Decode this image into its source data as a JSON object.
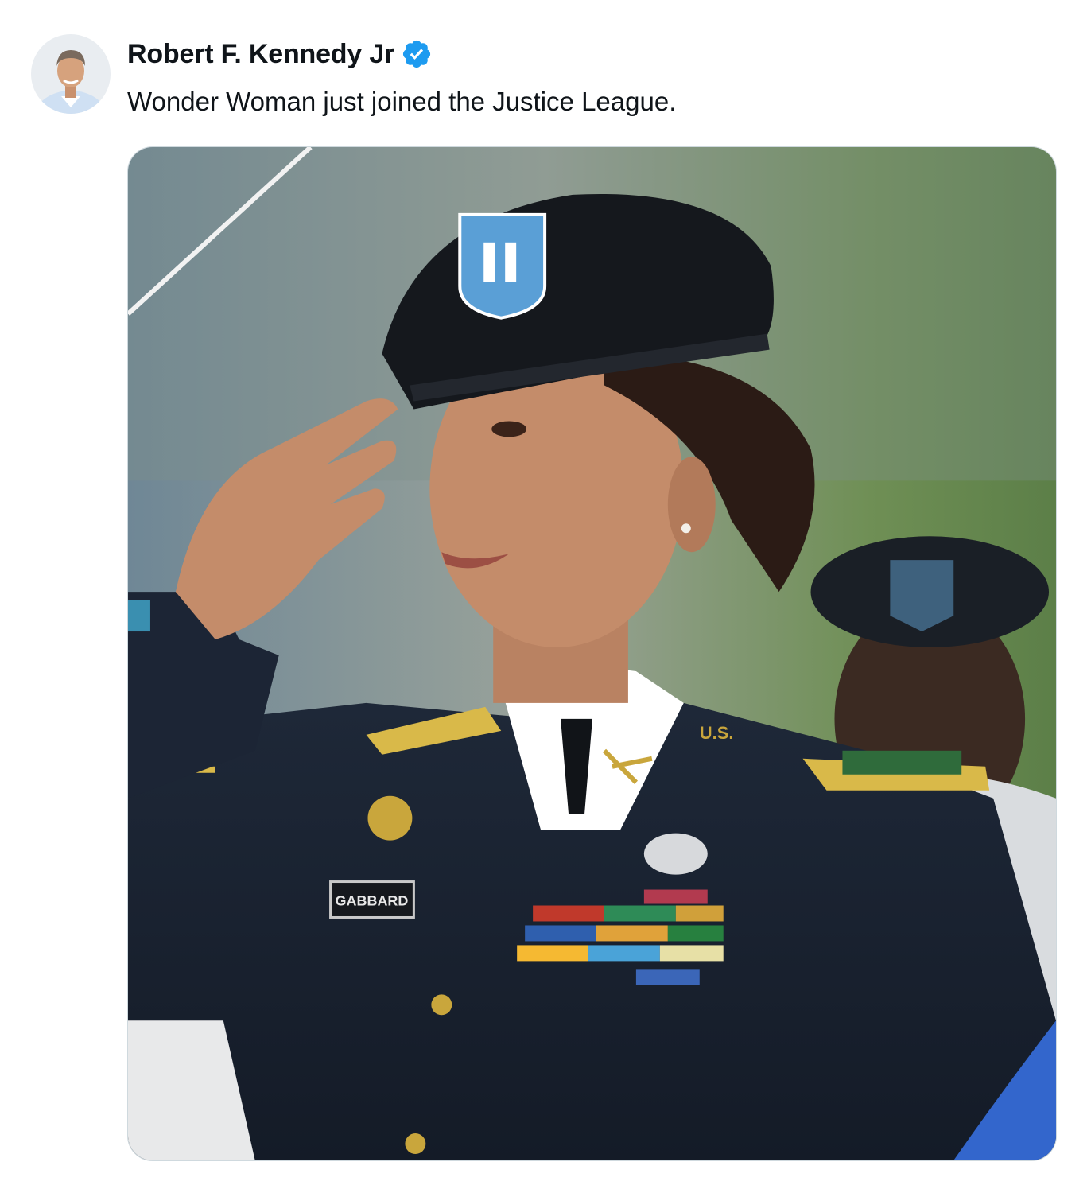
{
  "tweet": {
    "author": {
      "display_name": "Robert F. Kennedy Jr",
      "verified": true,
      "verified_color": "#1d9bf0",
      "avatar_icon": "profile-photo"
    },
    "text": "Wonder Woman just joined the Justice League.",
    "media": {
      "alt": "Photo of a uniformed soldier saluting",
      "name_tag": "GABBARD",
      "collar_insignia": "U.S."
    }
  }
}
